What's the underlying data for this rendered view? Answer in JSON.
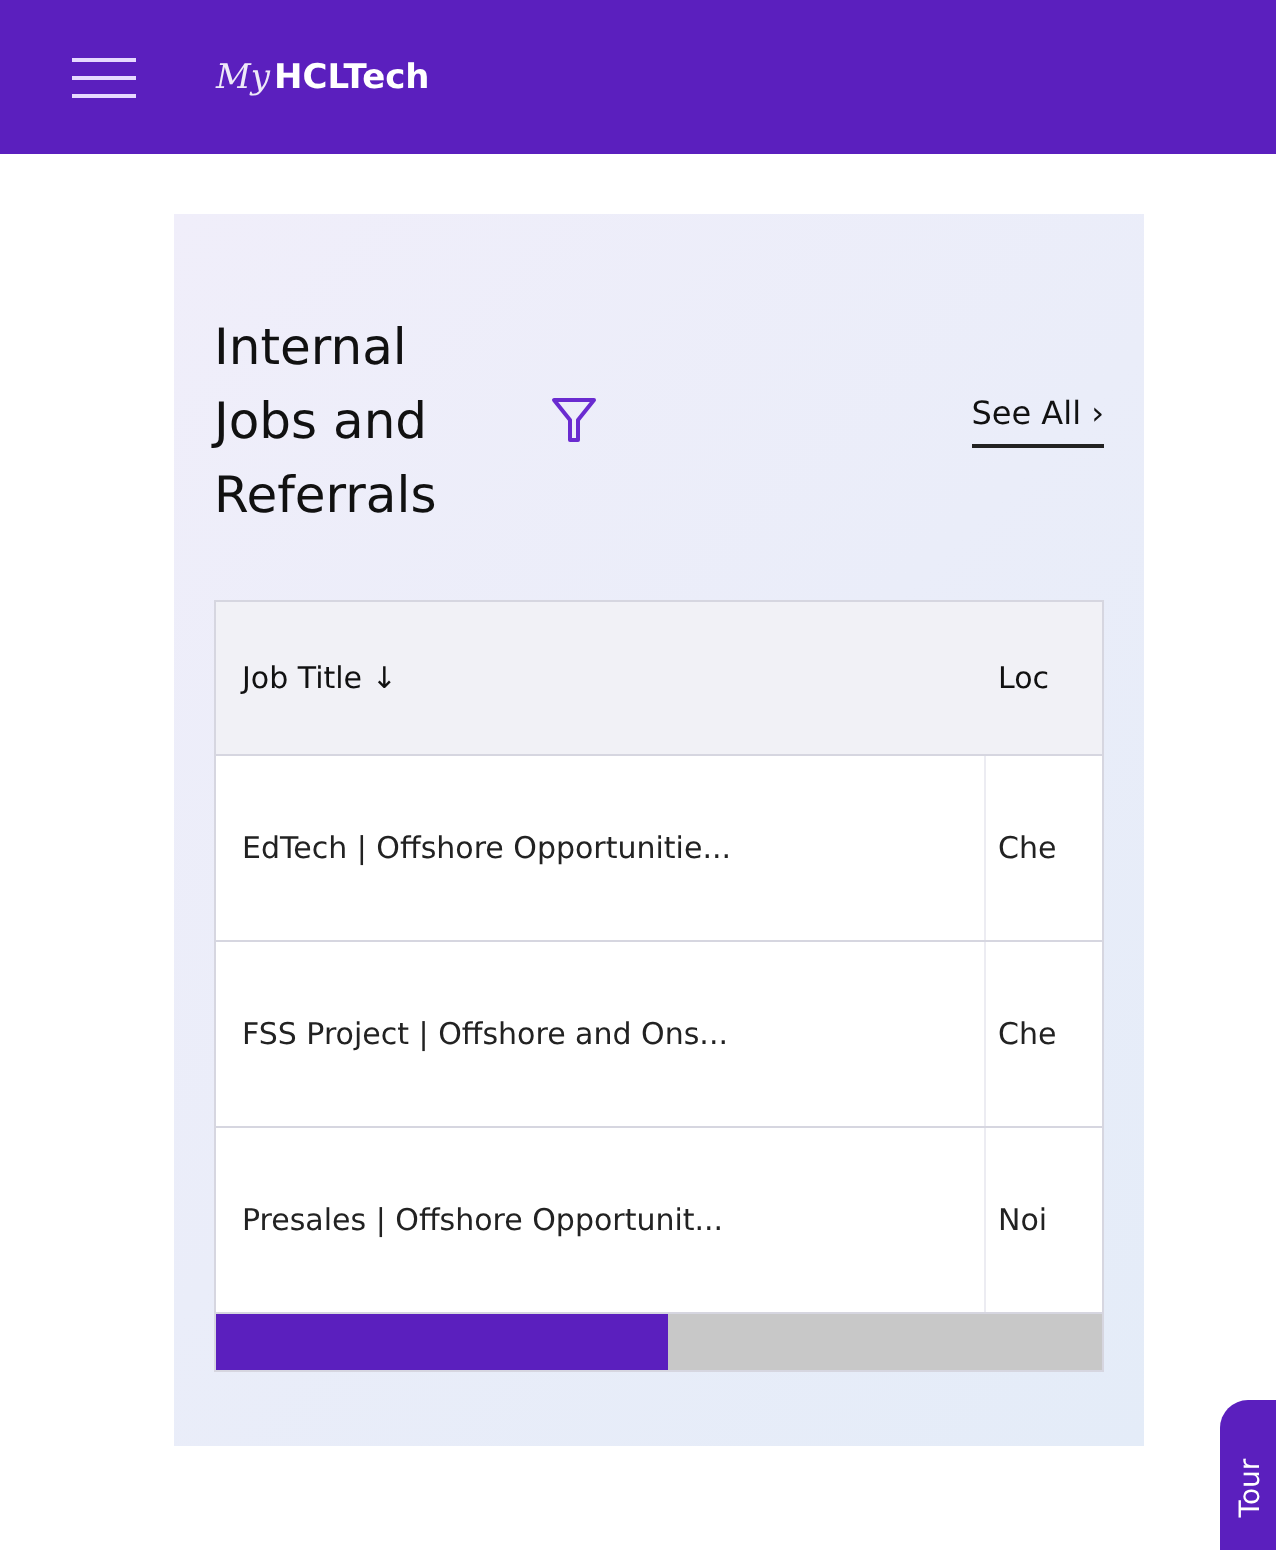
{
  "header": {
    "logo_script": "My",
    "logo_brand": "HCLTech"
  },
  "card": {
    "title": "Internal Jobs and Referrals",
    "see_all": "See All ›"
  },
  "table": {
    "columns": [
      {
        "label": "Job Title",
        "sort": "↓"
      },
      {
        "label": "Loc"
      }
    ],
    "rows": [
      [
        "EdTech | Offshore Opportunitie...",
        "Che"
      ],
      [
        "FSS Project | Offshore and Ons...",
        "Che"
      ],
      [
        "Presales | Offshore Opportunit...",
        "Noi"
      ]
    ],
    "scroll": {
      "level": 0.51
    }
  },
  "tour_tab": {
    "label": "Tour"
  }
}
